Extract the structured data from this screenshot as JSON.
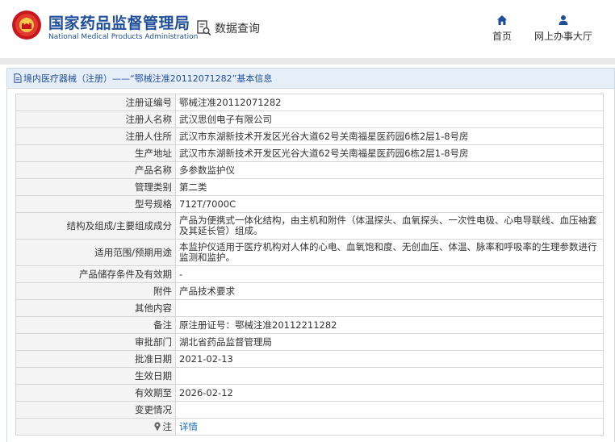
{
  "header": {
    "brand_cn": "国家药品监督管理局",
    "brand_en": "National Medical Products Administration",
    "query_label": "数据查询",
    "nav_home": "首页",
    "nav_hall": "网上办事大厅"
  },
  "breadcrumb": "境内医疗器械（注册）——“鄂械注准20112071282”基本信息",
  "rows": [
    {
      "label": "注册证编号",
      "value": "鄂械注准20112071282"
    },
    {
      "label": "注册人名称",
      "value": "武汉思创电子有限公司"
    },
    {
      "label": "注册人住所",
      "value": "武汉市东湖新技术开发区光谷大道62号关南福星医药园6栋2层1-8号房"
    },
    {
      "label": "生产地址",
      "value": "武汉市东湖新技术开发区光谷大道62号关南福星医药园6栋2层1-8号房"
    },
    {
      "label": "产品名称",
      "value": "多参数监护仪"
    },
    {
      "label": "管理类别",
      "value": "第二类"
    },
    {
      "label": "型号规格",
      "value": "712T/7000C"
    },
    {
      "label": "结构及组成/主要组成成分",
      "value": "产品为便携式一体化结构，由主机和附件（体温探头、血氧探头、一次性电极、心电导联线、血压袖套及其延长管）组成。"
    },
    {
      "label": "适用范围/预期用途",
      "value": "本监护仪适用于医疗机构对人体的心电、血氧饱和度、无创血压、体温、脉率和呼吸率的生理参数进行监测和监护。"
    },
    {
      "label": "产品储存条件及有效期",
      "value": "-"
    },
    {
      "label": "附件",
      "value": "产品技术要求"
    },
    {
      "label": "其他内容",
      "value": ""
    },
    {
      "label": "备注",
      "value": "原注册证号：鄂械注准20112211282"
    },
    {
      "label": "审批部门",
      "value": "湖北省药品监督管理局"
    },
    {
      "label": "批准日期",
      "value": "2021-02-13"
    },
    {
      "label": "生效日期",
      "value": ""
    },
    {
      "label": "有效期至",
      "value": "2026-02-12"
    },
    {
      "label": "变更情况",
      "value": ""
    },
    {
      "label": "注",
      "value": "详情"
    }
  ],
  "colors": {
    "brand": "#1f4f9a",
    "link": "#1f6fc8",
    "label_bg": "#f4f4f4",
    "crumb_bg": "#e6eef8"
  }
}
